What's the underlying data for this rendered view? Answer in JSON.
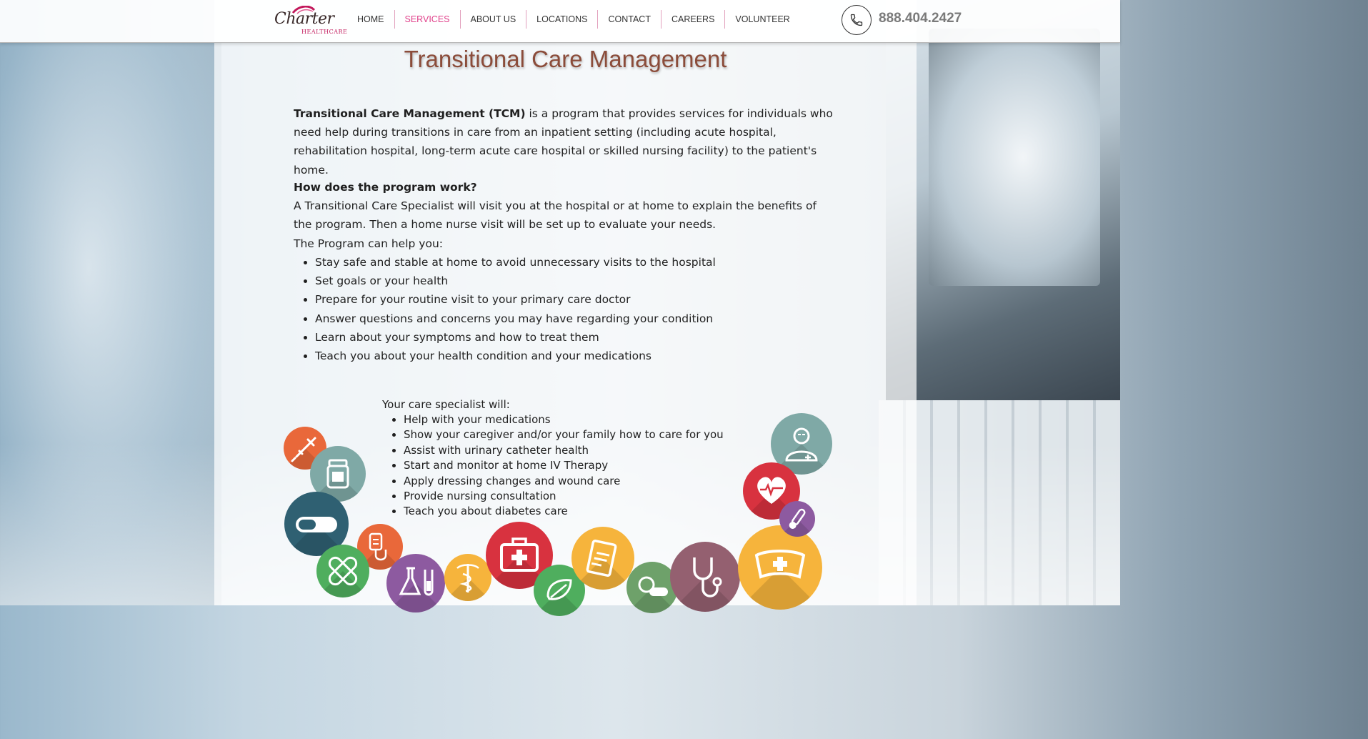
{
  "header": {
    "logo_script": "Charter",
    "logo_sub": "HEALTHCARE",
    "nav": [
      "HOME",
      "SERVICES",
      "ABOUT US",
      "LOCATIONS",
      "CONTACT",
      "CAREERS",
      "VOLUNTEER"
    ],
    "active_nav": "SERVICES",
    "phone": "888.404.2427"
  },
  "main": {
    "title": "Transitional Care Management",
    "intro_bold": "Transitional Care Management (TCM)",
    "intro_rest": " is a program that provides services for individuals who need help during transitions in care from an inpatient setting (including acute hospital, rehabilitation hospital, long-term acute care hospital or skilled nursing facility) to the patient's home.",
    "question": "How does the program work?",
    "explanation": "A Transitional Care Specialist will visit you at the hospital or at home to explain the benefits of the program. Then a home nurse visit will be set up to evaluate your needs.",
    "help_intro": "The Program can help you:",
    "help_items": [
      "Stay safe and stable at home to avoid unnecessary visits to the hospital",
      "Set goals or your health",
      "Prepare for your routine visit to your primary care doctor",
      "Answer questions and concerns you may have regarding your condition",
      "Learn about your symptoms and how to treat them",
      "Teach you about your health condition and your medications"
    ],
    "specialist_intro": "Your care specialist will:",
    "specialist_items": [
      "Help with your medications",
      "Show your caregiver and/or your family how to care for you",
      "Assist with urinary catheter health",
      "Start and monitor at home IV Therapy",
      "Apply dressing changes and wound care",
      "Provide nursing consultation",
      "Teach you about diabetes care"
    ]
  },
  "icons": [
    {
      "name": "syringe-icon",
      "color": "#e9683a"
    },
    {
      "name": "pill-bottle-icon",
      "color": "#7fa9a6"
    },
    {
      "name": "capsule-icon",
      "color": "#2f6072"
    },
    {
      "name": "iv-bag-icon",
      "color": "#e9683a"
    },
    {
      "name": "bandage-icon",
      "color": "#4fae5e"
    },
    {
      "name": "lab-flask-icon",
      "color": "#8d5aa0"
    },
    {
      "name": "caduceus-icon",
      "color": "#f6b43c"
    },
    {
      "name": "first-aid-kit-icon",
      "color": "#d8323f"
    },
    {
      "name": "leaf-icon",
      "color": "#4fae5e"
    },
    {
      "name": "clipboard-icon",
      "color": "#f6b43c"
    },
    {
      "name": "pills-icon",
      "color": "#6ea16a"
    },
    {
      "name": "stethoscope-icon",
      "color": "#946070"
    },
    {
      "name": "nurse-cap-icon",
      "color": "#f6b43c"
    },
    {
      "name": "doctor-icon",
      "color": "#7fa9a6"
    },
    {
      "name": "heartbeat-icon",
      "color": "#d8323f"
    },
    {
      "name": "thermometer-icon",
      "color": "#8d5aa0"
    }
  ]
}
